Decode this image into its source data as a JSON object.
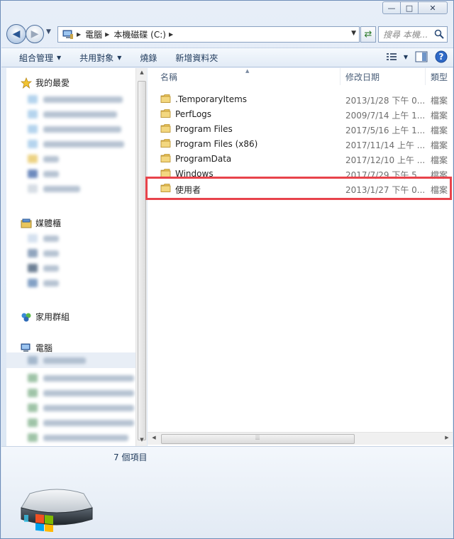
{
  "window": {
    "caption_minimize": "—",
    "caption_maximize": "□",
    "caption_close": "✕"
  },
  "address": {
    "crumbs": [
      "電腦",
      "本機磁碟 (C:)"
    ],
    "search_placeholder": "搜尋 本機..."
  },
  "toolbar": {
    "organize": "組合管理",
    "share": "共用對象",
    "burn": "燒錄",
    "new_folder": "新增資料夾"
  },
  "nav": {
    "favorites": "我的最愛",
    "libraries": "媒體櫃",
    "homegroup": "家用群組",
    "computer": "電腦"
  },
  "columns": {
    "name": "名稱",
    "date": "修改日期",
    "type": "類型"
  },
  "files": [
    {
      "name": ".TemporaryItems",
      "date": "2013/1/28 下午 0...",
      "type": "檔案"
    },
    {
      "name": "PerfLogs",
      "date": "2009/7/14 上午 1...",
      "type": "檔案"
    },
    {
      "name": "Program Files",
      "date": "2017/5/16 上午 1...",
      "type": "檔案"
    },
    {
      "name": "Program Files (x86)",
      "date": "2017/11/14 上午 ...",
      "type": "檔案"
    },
    {
      "name": "ProgramData",
      "date": "2017/12/10 上午 ...",
      "type": "檔案"
    },
    {
      "name": "Windows",
      "date": "2017/7/29 下午 5...",
      "type": "檔案"
    },
    {
      "name": "使用者",
      "date": "2013/1/27 下午 0...",
      "type": "檔案"
    }
  ],
  "details": {
    "item_count": "7 個項目"
  },
  "colors": {
    "highlight": "#e8434b",
    "folder": "#e8c35a",
    "accent": "#1e395b"
  }
}
